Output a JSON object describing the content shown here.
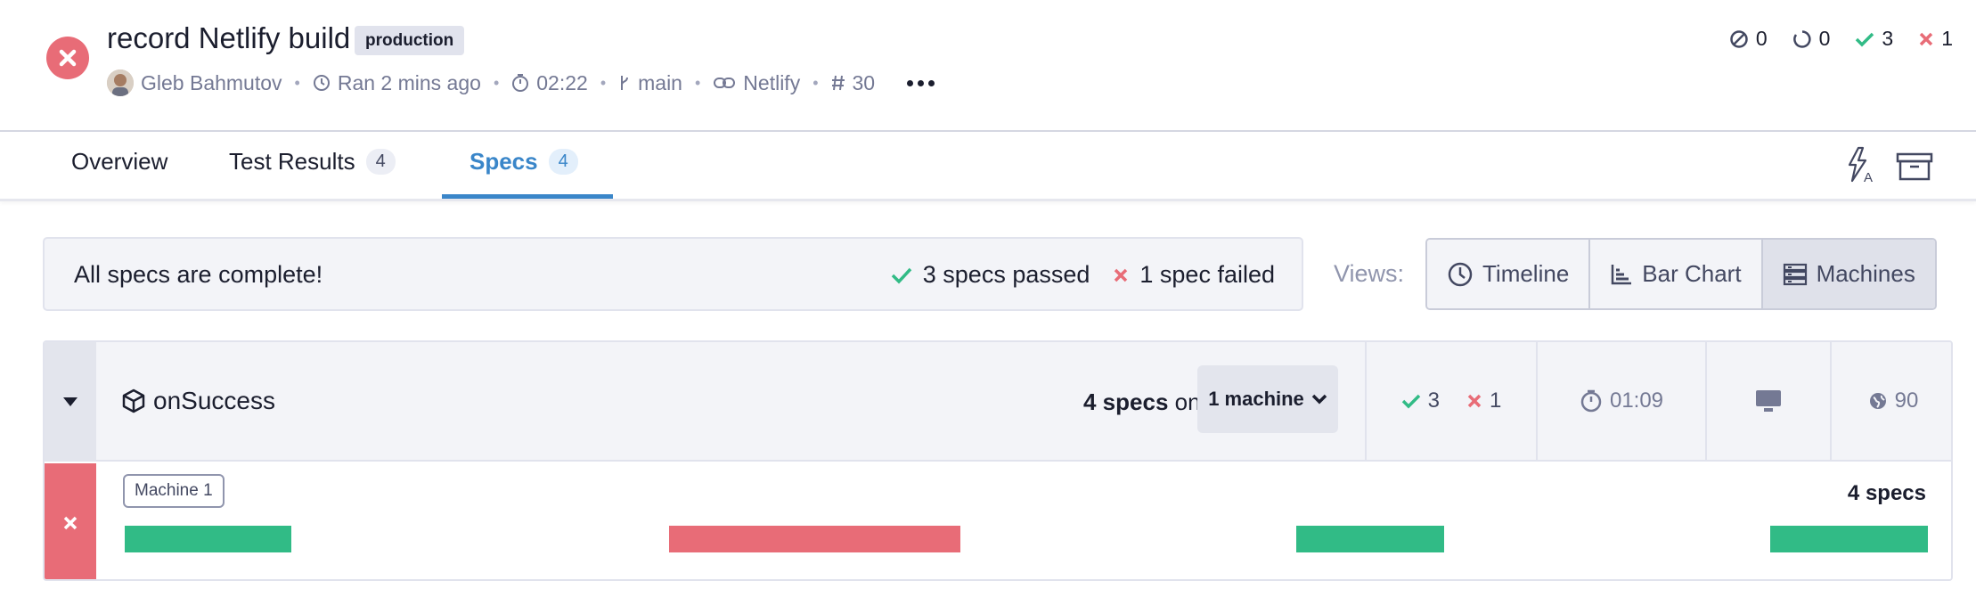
{
  "header": {
    "title": "record Netlify build",
    "env_badge": "production",
    "author": "Gleb Bahmutov",
    "ran": "Ran 2 mins ago",
    "duration": "02:22",
    "branch": "main",
    "integration": "Netlify",
    "run_number": "30"
  },
  "counts": {
    "skipped": "0",
    "pending": "0",
    "passed": "3",
    "failed": "1"
  },
  "tabs": [
    {
      "label": "Overview",
      "count": ""
    },
    {
      "label": "Test Results",
      "count": "4"
    },
    {
      "label": "Specs",
      "count": "4"
    }
  ],
  "summary": {
    "message": "All specs are complete!",
    "passed": "3 specs passed",
    "failed": "1 spec failed"
  },
  "views": {
    "label": "Views:",
    "options": [
      "Timeline",
      "Bar Chart",
      "Machines"
    ],
    "selected": "Machines"
  },
  "group": {
    "name": "onSuccess",
    "spec_count": "4 specs",
    "on_text": "on",
    "machine_label": "1 machine",
    "passed": "3",
    "failed": "1",
    "duration": "01:09",
    "score": "90"
  },
  "machine_row": {
    "tag": "Machine 1",
    "spec_count": "4 specs",
    "status": "failed",
    "specs": [
      {
        "status": "passed"
      },
      {
        "status": "failed"
      },
      {
        "status": "passed"
      },
      {
        "status": "passed"
      }
    ]
  },
  "colors": {
    "passed": "#31bb86",
    "failed": "#e86c77",
    "accent": "#3a86c9"
  },
  "icons": [
    "x-circle-icon",
    "clock-icon",
    "stopwatch-icon",
    "branch-icon",
    "link-icon",
    "hash-icon",
    "more-icon",
    "skipped-icon",
    "pending-icon",
    "check-icon",
    "x-icon",
    "flash-a-icon",
    "archive-icon",
    "timeline-icon",
    "bar-chart-icon",
    "machines-icon",
    "caret-down-icon",
    "cube-icon",
    "chevron-down-icon",
    "monitor-icon",
    "globe-icon"
  ]
}
